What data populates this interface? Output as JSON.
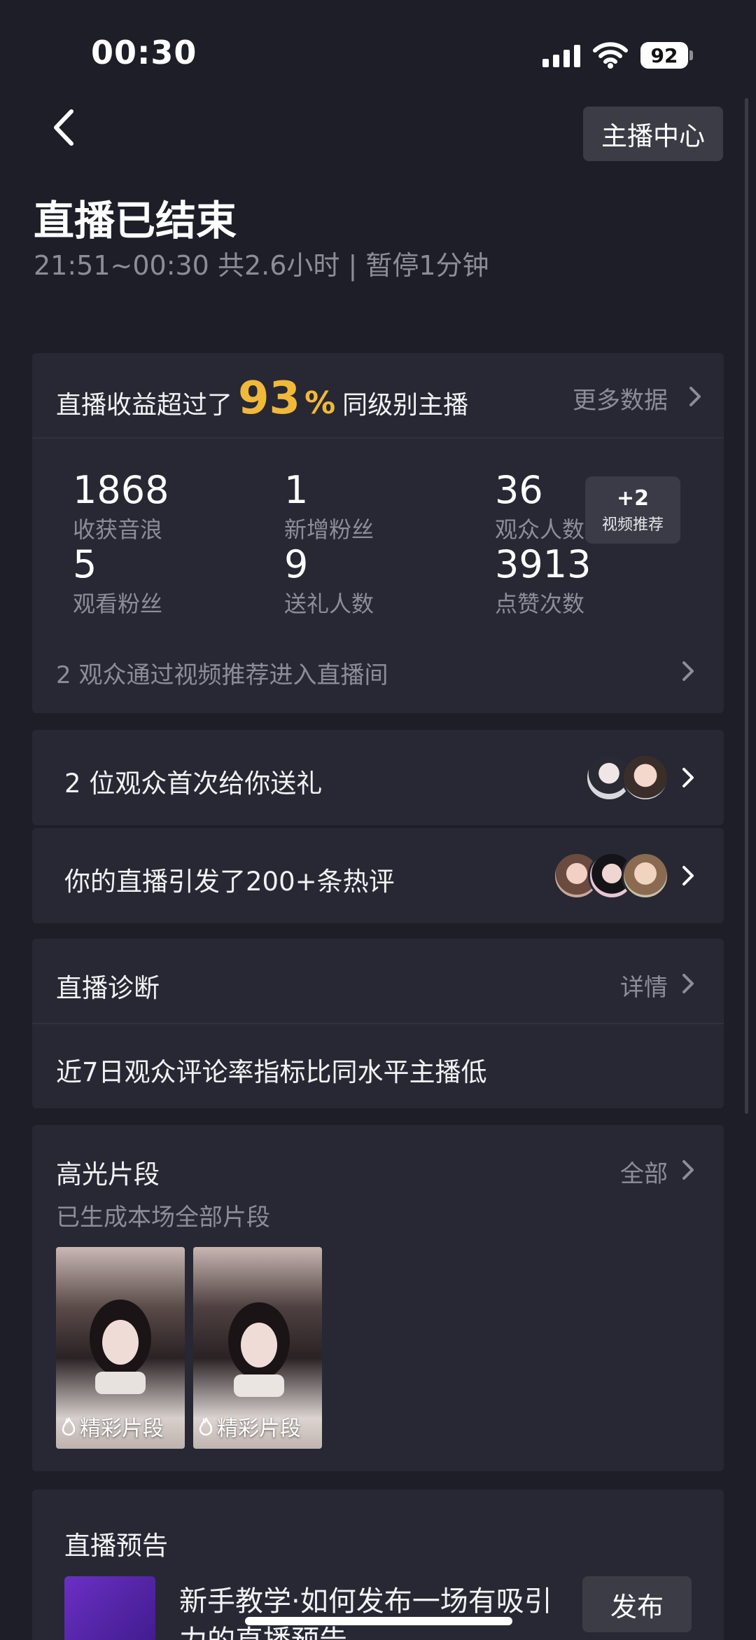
{
  "status_bar": {
    "time": "00:30",
    "battery": "92"
  },
  "header": {
    "host_center": "主播中心",
    "title": "直播已结束",
    "subtitle": "21:51~00:30 共2.6小时 | 暂停1分钟"
  },
  "earnings": {
    "prefix": "直播收益超过了",
    "percent": "93",
    "percent_sign": "%",
    "suffix": "同级别主播",
    "more": "更多数据",
    "stats": [
      {
        "value": "1868",
        "label": "收获音浪"
      },
      {
        "value": "1",
        "label": "新增粉丝"
      },
      {
        "value": "36",
        "label": "观众人数"
      },
      {
        "value": "5",
        "label": "观看粉丝"
      },
      {
        "value": "9",
        "label": "送礼人数"
      },
      {
        "value": "3913",
        "label": "点赞次数"
      }
    ],
    "rec_badge": {
      "count": "+2",
      "label": "视频推荐"
    },
    "rec_line": "2 观众通过视频推荐进入直播间"
  },
  "gift_row": {
    "text": "2 位观众首次给你送礼"
  },
  "comment_row": {
    "text": "你的直播引发了200+条热评"
  },
  "diagnosis": {
    "title": "直播诊断",
    "detail": "详情",
    "text": "近7日观众评论率指标比同水平主播低"
  },
  "highlights": {
    "title": "高光片段",
    "all": "全部",
    "subtitle": "已生成本场全部片段",
    "clips": [
      {
        "label": "精彩片段"
      },
      {
        "label": "精彩片段"
      }
    ]
  },
  "preview": {
    "title": "直播预告",
    "text": "新手教学·如何发布一场有吸引力的直播预告",
    "button": "发布"
  },
  "colors": {
    "accent": "#f0b93a",
    "background": "#1d1e28",
    "card": "#272833",
    "muted": "#8c8d98"
  }
}
